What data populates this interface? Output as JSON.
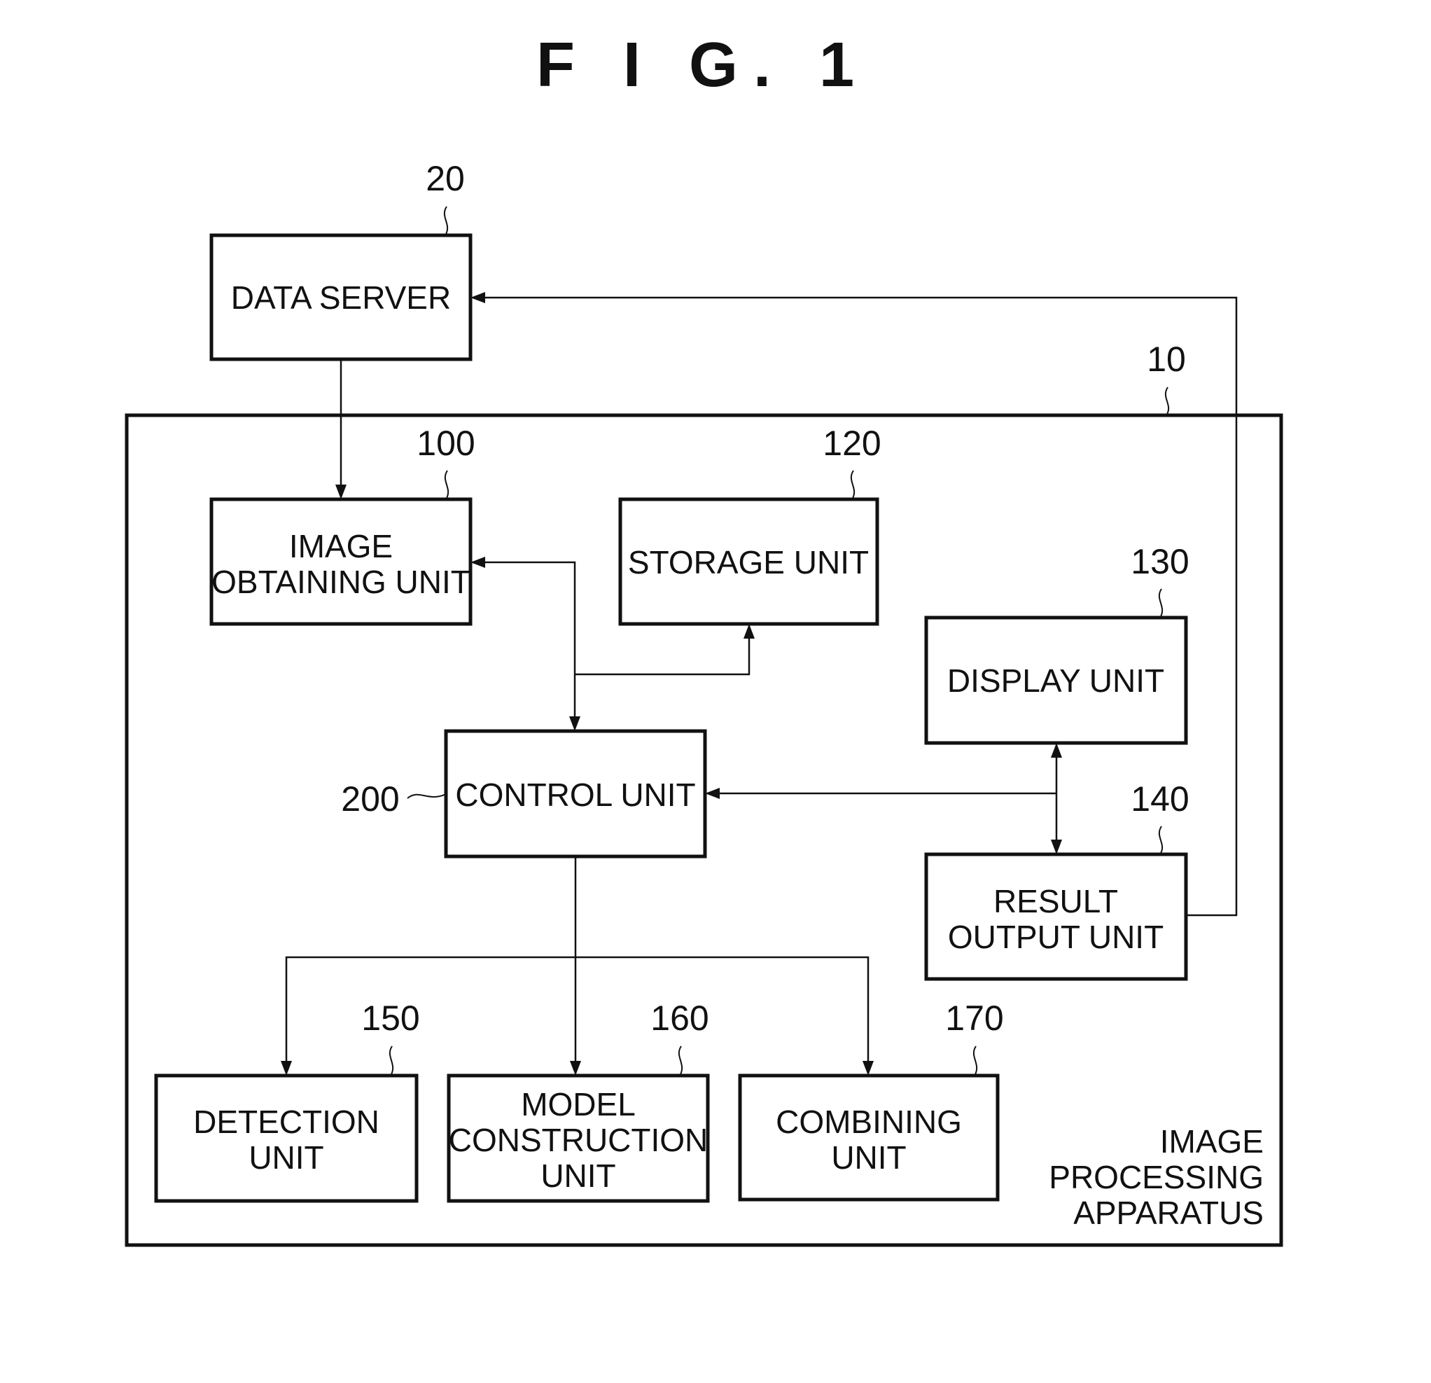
{
  "figure": {
    "title": "F I G. 1"
  },
  "blocks": {
    "data_server": {
      "ref": "20",
      "lines": [
        "DATA SERVER"
      ]
    },
    "apparatus": {
      "ref": "10",
      "lines": [
        "IMAGE",
        "PROCESSING",
        "APPARATUS"
      ]
    },
    "image_obtaining": {
      "ref": "100",
      "lines": [
        "IMAGE",
        "OBTAINING UNIT"
      ]
    },
    "storage": {
      "ref": "120",
      "lines": [
        "STORAGE UNIT"
      ]
    },
    "display": {
      "ref": "130",
      "lines": [
        "DISPLAY UNIT"
      ]
    },
    "result_output": {
      "ref": "140",
      "lines": [
        "RESULT",
        "OUTPUT UNIT"
      ]
    },
    "control": {
      "ref": "200",
      "lines": [
        "CONTROL UNIT"
      ]
    },
    "detection": {
      "ref": "150",
      "lines": [
        "DETECTION",
        "UNIT"
      ]
    },
    "model_construction": {
      "ref": "160",
      "lines": [
        "MODEL",
        "CONSTRUCTION",
        "UNIT"
      ]
    },
    "combining": {
      "ref": "170",
      "lines": [
        "COMBINING",
        "UNIT"
      ]
    }
  },
  "connections": [
    {
      "from": "data_server",
      "to": "image_obtaining",
      "direction": "one-way"
    },
    {
      "from": "control",
      "to": "image_obtaining",
      "direction": "two-way"
    },
    {
      "from": "control",
      "to": "storage",
      "direction": "two-way"
    },
    {
      "from": "display",
      "to": "control",
      "direction": "one-way"
    },
    {
      "from": "display",
      "to": "result_output",
      "direction": "two-way"
    },
    {
      "from": "result_output",
      "to": "data_server",
      "direction": "one-way"
    },
    {
      "from": "control",
      "to": "detection",
      "direction": "one-way"
    },
    {
      "from": "control",
      "to": "model_construction",
      "direction": "one-way"
    },
    {
      "from": "control",
      "to": "combining",
      "direction": "one-way"
    }
  ]
}
